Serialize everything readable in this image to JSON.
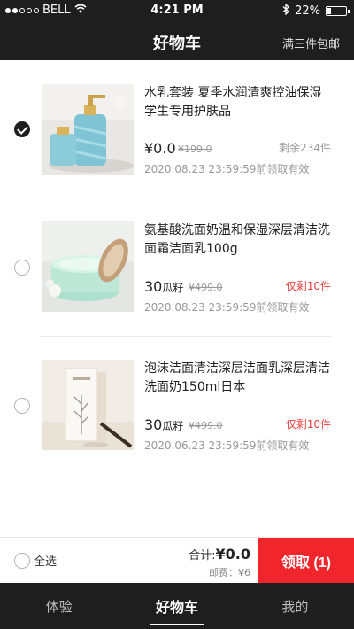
{
  "status_bar": {
    "carrier": "BELL",
    "time": "4:21 PM",
    "battery": "22%",
    "battery_level": 0.22,
    "icons": [
      "signal-dots-icon",
      "wifi-icon",
      "bluetooth-icon",
      "battery-icon"
    ]
  },
  "header": {
    "title": "好物车",
    "promo": "满三件包邮"
  },
  "items": [
    {
      "name": "水乳套装 夏季水润清爽控油保湿学生专用护肤品",
      "price_value": "¥0.0",
      "price_unit": "",
      "original_price": "¥199.0",
      "stock": "剩余234件",
      "stock_urgent": false,
      "expiry": "2020.08.23 23:59:59前领取有效",
      "selected": true
    },
    {
      "name": "氨基酸洗面奶温和保湿深层清洁洗面霜洁面乳100g",
      "price_value": "30",
      "price_unit": "瓜籽",
      "original_price": "¥499.0",
      "stock": "仅剩10件",
      "stock_urgent": true,
      "expiry": "2020.08.23 23:59:59前领取有效",
      "selected": false
    },
    {
      "name": "泡沫洁面清洁深层洁面乳深层清洁洗面奶150ml日本",
      "price_value": "30",
      "price_unit": "瓜籽",
      "original_price": "¥499.0",
      "stock": "仅剩10件",
      "stock_urgent": true,
      "expiry": "2020.06.23 23:59:59前领取有效",
      "selected": false
    }
  ],
  "footer": {
    "select_all": "全选",
    "total_label": "合计:",
    "total_value": "¥0.0",
    "shipping": "邮费：¥6",
    "claim_button": "领取 (1)"
  },
  "tabs": [
    {
      "label": "体验",
      "active": false
    },
    {
      "label": "好物车",
      "active": true
    },
    {
      "label": "我的",
      "active": false
    }
  ],
  "colors": {
    "bar_background": "#1e1e1e",
    "accent_red": "#f0262c",
    "urgent_red": "#e53b3b"
  }
}
